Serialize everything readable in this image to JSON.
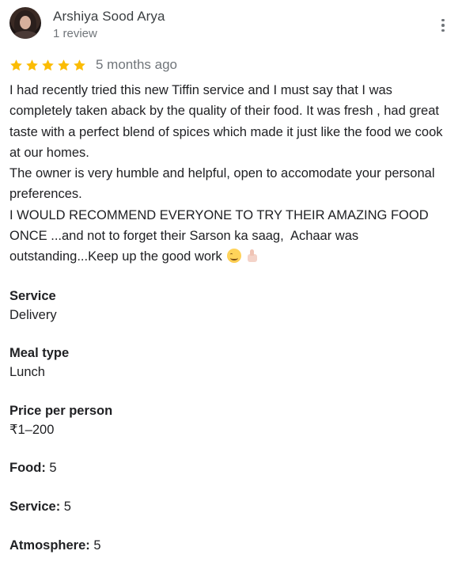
{
  "reviewer": {
    "name": "Arshiya Sood Arya",
    "meta": "1 review"
  },
  "review": {
    "rating": 5,
    "rating_max": 5,
    "star_color": "#fbbc04",
    "time": "5 months ago",
    "text_before_emoji": "I had recently tried this new Tiffin service and I must say that I was completely taken aback by the quality of their food. It was fresh , had great taste with a perfect blend of spices which made it just like the food we cook at our homes.\nThe owner is very humble and helpful, open to accomodate your personal preferences.\nI WOULD RECOMMEND EVERYONE TO TRY THEIR AMAZING FOOD ONCE ...and not to forget their Sarson ka saag,  Achaar was outstanding...Keep up the good work ",
    "emojis": [
      "smiling-face-emoji",
      "thumbs-up-emoji"
    ]
  },
  "attributes": {
    "service": {
      "label": "Service",
      "value": "Delivery"
    },
    "meal_type": {
      "label": "Meal type",
      "value": "Lunch"
    },
    "price": {
      "label": "Price per person",
      "value": "₹1–200"
    },
    "food": {
      "label": "Food:",
      "value": "5"
    },
    "service_rating": {
      "label": "Service:",
      "value": "5"
    },
    "atmosphere": {
      "label": "Atmosphere:",
      "value": "5"
    }
  },
  "icons": {
    "more": "more-vert-icon",
    "star": "star-icon"
  }
}
